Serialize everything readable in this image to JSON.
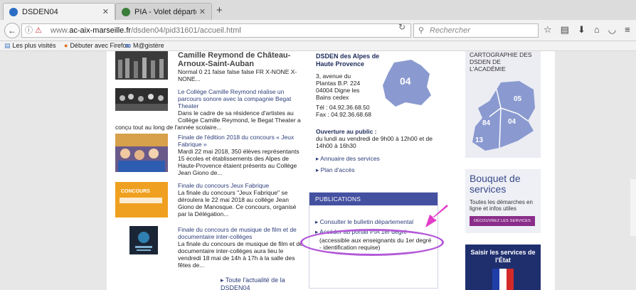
{
  "browser": {
    "tabs": [
      {
        "label": "DSDEN04",
        "close": "✕",
        "favicon_color": "#2b6cc4"
      },
      {
        "label": "PIA - Volet départemental ...",
        "close": "✕",
        "favicon_color": "#3a7d3a"
      }
    ],
    "new_tab": "+",
    "url_prefix": "www.",
    "url_domain": "ac-aix-marseille.fr",
    "url_path": "/dsden04/pid31601/accueil.html",
    "search_placeholder": "Rechercher",
    "bookmarks": [
      "Les plus visités",
      "Débuter avec Firefox",
      "M@gistère"
    ]
  },
  "news": {
    "items": [
      {
        "title": "Camille Reymond de Château-Arnoux-Saint-Auban",
        "body": "Normal 0 21 false false false FR X-NONE X-NONE..."
      },
      {
        "title": "Le Collège Camille Reymond réalise un parcours sonore avec la compagnie Begat Theater",
        "body": "Dans le cadre de sa résidence d'artistes au Collège Camille Reymond, le Begat Theater a",
        "overflow": "conçu tout au long de l'année scolaire..."
      },
      {
        "title": "Finale de l'édition 2018 du concours « Jeux Fabrique »",
        "body": "Mardi 22 mai 2018,  350 élèves représentants 15 écoles et établissements des Alpes de Haute-Provence étaient présents au Collège Jean Giono de..."
      },
      {
        "title": "Finale du concours Jeux Fabrique",
        "body": "La finale du concours \"Jeux Fabrique\" se déroulera le 22 mai 2018 au collège Jean Giono de Manosque. Ce concours, organisé par la Délégation...",
        "thumb_text": "CONCOURS"
      },
      {
        "title": "Finale du concours de musique de film et de documentaire inter-collèges",
        "body": "La finale du concours de musique de film et de documentaire inter-collèges aura lieu le vendredi 18 mai de 14h à 17h à la salle des fêtes de..."
      }
    ],
    "all_news": "Toute l'actualité de la DSDEN04"
  },
  "contact": {
    "name": "DSDEN des Alpes de Haute Provence",
    "address": "3, avenue du Plantas B.P. 224 04004 Digne les Bains cedex",
    "phone": "Tél : 04.92.36.68.50",
    "fax": "Fax : 04.92.36.68.68",
    "hours_title": "Ouverture au public :",
    "hours": "du lundi au vendredi de 9h00 à 12h00 et de 14h00 à 16h30",
    "links": [
      "Annuaire des services",
      "Plan d'accès"
    ],
    "map_label": "04"
  },
  "publications": {
    "header": "PUBLICATIONS",
    "link1": "Consulter le bulletin départemental",
    "link2": "Accéder au portail PIA 1er degré",
    "note": "(accessible aux enseignants du 1er degré - identification requise)"
  },
  "sidebar": {
    "services_text": "DSDEN DE L'ACADÉMIE",
    "services_text_top": "CARTOGRAPHIE DES",
    "region_labels": [
      "05",
      "84",
      "04",
      "13"
    ],
    "bouquet_title": "Bouquet de services",
    "bouquet_sub": "Toutes les démarches en ligne et infos utiles",
    "bouquet_button": "DÉCOUVREZ LES SERVICES",
    "state_title": "Saisir les services de l'État"
  },
  "colors": {
    "accent": "#4450a0",
    "highlight": "#b35ad8",
    "arrow": "#e23cc8",
    "map": "#8a9ad0"
  }
}
